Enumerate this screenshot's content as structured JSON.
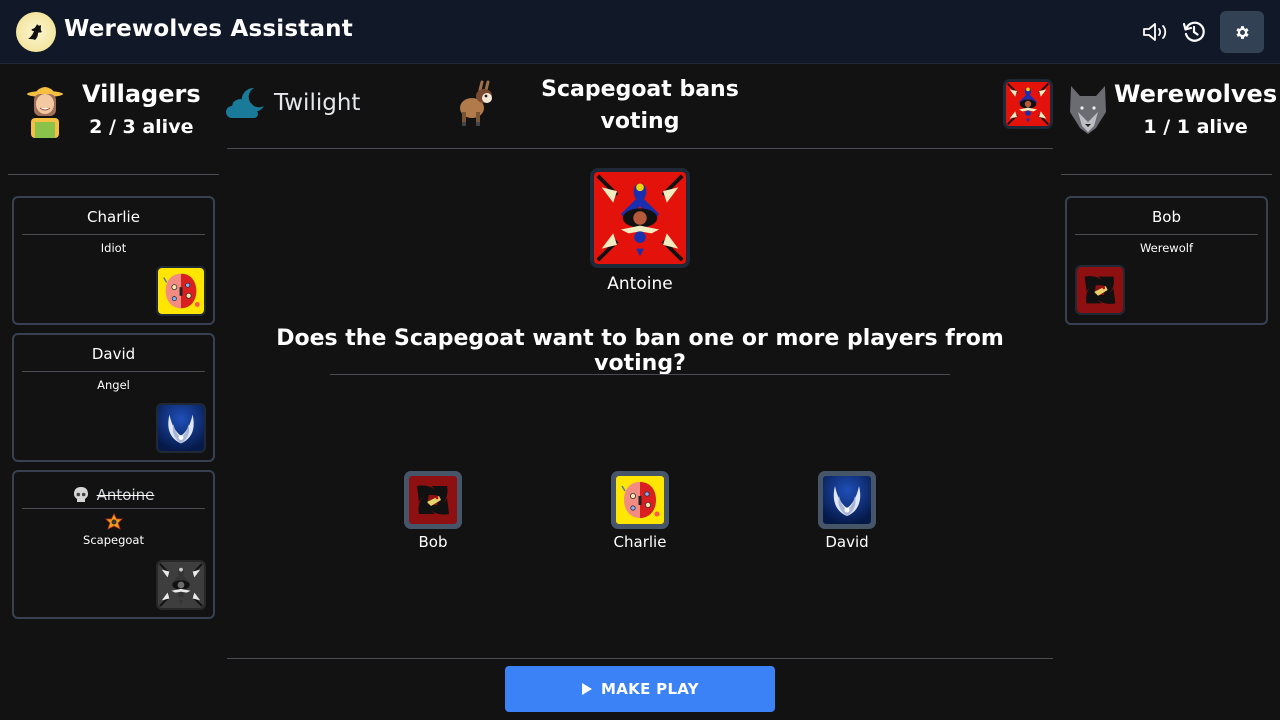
{
  "app": {
    "title": "Werewolves Assistant",
    "logo_icon": "wolf-moon-icon"
  },
  "topbar": {
    "sound_icon": "speaker-icon",
    "history_icon": "history-icon",
    "settings_icon": "gear-icon"
  },
  "villagers": {
    "name": "Villagers",
    "alive": "2 / 3 alive",
    "icon": "farmer-icon",
    "players": [
      {
        "name": "Charlie",
        "role": "Idiot",
        "dead": false,
        "role_icon": "idiot-role-icon"
      },
      {
        "name": "David",
        "role": "Angel",
        "dead": false,
        "role_icon": "angel-role-icon"
      },
      {
        "name": "Antoine",
        "role": "Scapegoat",
        "dead": true,
        "role_icon": "scapegoat-role-icon",
        "status_icon": "skull-icon",
        "attribute_icon": "sheriff-star-icon"
      }
    ]
  },
  "werewolves": {
    "name": "Werewolves",
    "alive": "1 / 1 alive",
    "icon": "wolf-head-icon",
    "players": [
      {
        "name": "Bob",
        "role": "Werewolf",
        "dead": false,
        "role_icon": "werewolf-role-icon"
      }
    ]
  },
  "phase": {
    "label": "Twilight",
    "icon": "cloud-moon-icon"
  },
  "step": {
    "title": "Scapegoat bans voting",
    "icon": "goat-icon",
    "source_icon": "scapegoat-role-icon"
  },
  "play": {
    "source_player": "Antoine",
    "question": "Does the Scapegoat want to ban one or more players from voting?",
    "targets": [
      {
        "name": "Bob",
        "icon": "werewolf-role-icon"
      },
      {
        "name": "Charlie",
        "icon": "idiot-role-icon"
      },
      {
        "name": "David",
        "icon": "angel-role-icon"
      }
    ]
  },
  "actions": {
    "make_play": "MAKE PLAY",
    "make_play_icon": "play-icon"
  },
  "colors": {
    "topbar": "#111827",
    "background": "#121212",
    "primary": "#3b82f6",
    "card_border": "#374151"
  }
}
